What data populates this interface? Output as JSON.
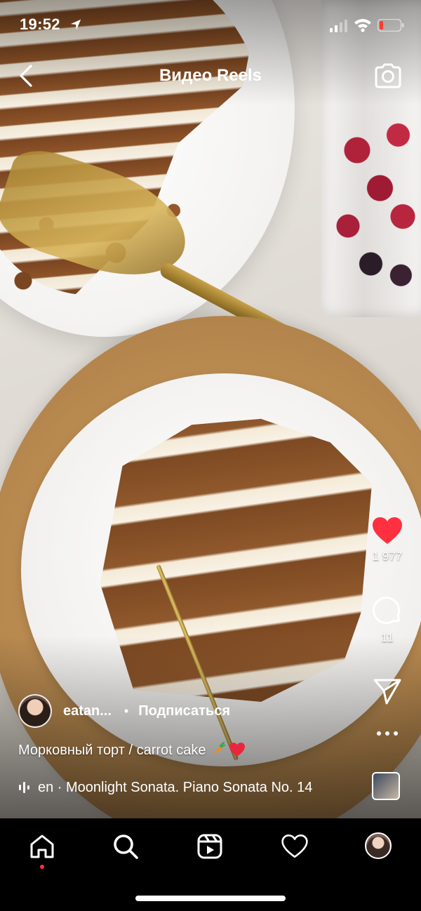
{
  "status_bar": {
    "time": "19:52",
    "icons": [
      "location-arrow-icon",
      "signal-icon",
      "wifi-icon",
      "battery-icon"
    ],
    "battery_color": "#ff3b30"
  },
  "header": {
    "title": "Видео Reels",
    "back_icon": "chevron-left-icon",
    "camera_icon": "camera-icon"
  },
  "actions": {
    "like_count": "1 977",
    "like_color": "#ff3040",
    "comment_count": "11",
    "share_icon": "paper-plane-icon",
    "more_icon": "more-horizontal-icon"
  },
  "post": {
    "username": "eatan...",
    "separator": "•",
    "follow_label": "Подписаться",
    "caption": "Морковный торт / carrot cake",
    "caption_emojis": [
      "carrot-icon",
      "heart-icon"
    ]
  },
  "music": {
    "track_text": "en · Moonlight Sonata. Piano Sonata No. 14"
  },
  "tab_bar": {
    "items": [
      {
        "name": "home",
        "icon": "home-icon",
        "active": true
      },
      {
        "name": "search",
        "icon": "search-icon",
        "active": false
      },
      {
        "name": "reels",
        "icon": "reels-icon",
        "active": false
      },
      {
        "name": "activity",
        "icon": "heart-outline-icon",
        "active": false
      },
      {
        "name": "profile",
        "icon": "avatar",
        "active": false
      }
    ],
    "active_dot_color": "#ff3040"
  }
}
